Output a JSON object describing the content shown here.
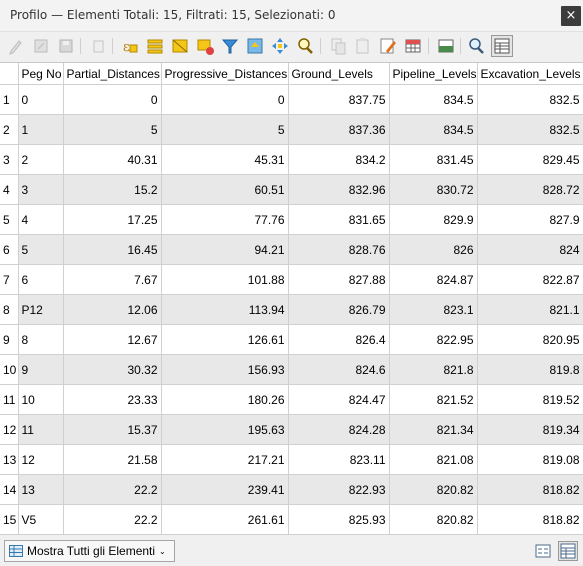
{
  "window": {
    "title": "Profilo — Elementi Totali: 15,  Filtrati: 15, Selezionati: 0",
    "close_glyph": "×"
  },
  "toolbar": {
    "icons": [
      "pencil-icon",
      "save-edits-icon",
      "save-icon",
      "delete-icon",
      "select-expression-icon",
      "select-all-icon",
      "invert-selection-icon",
      "deselect-icon",
      "filter-icon",
      "move-to-top-icon",
      "pan-to-icon",
      "zoom-to-icon",
      "copy-icon",
      "paste-icon",
      "field-calculator-icon",
      "conditional-format-icon",
      "dock-icon",
      "form-view-icon",
      "table-view-icon"
    ]
  },
  "table": {
    "columns": [
      "Peg No",
      "Partial_Distances",
      "Progressive_Distances",
      "Ground_Levels",
      "Pipeline_Levels",
      "Excavation_Levels"
    ],
    "rows": [
      {
        "n": "1",
        "peg": "0",
        "partial": "0",
        "progressive": "0",
        "ground": "837.75",
        "pipeline": "834.5",
        "excavation": "832.5"
      },
      {
        "n": "2",
        "peg": "1",
        "partial": "5",
        "progressive": "5",
        "ground": "837.36",
        "pipeline": "834.5",
        "excavation": "832.5"
      },
      {
        "n": "3",
        "peg": "2",
        "partial": "40.31",
        "progressive": "45.31",
        "ground": "834.2",
        "pipeline": "831.45",
        "excavation": "829.45"
      },
      {
        "n": "4",
        "peg": "3",
        "partial": "15.2",
        "progressive": "60.51",
        "ground": "832.96",
        "pipeline": "830.72",
        "excavation": "828.72"
      },
      {
        "n": "5",
        "peg": "4",
        "partial": "17.25",
        "progressive": "77.76",
        "ground": "831.65",
        "pipeline": "829.9",
        "excavation": "827.9"
      },
      {
        "n": "6",
        "peg": "5",
        "partial": "16.45",
        "progressive": "94.21",
        "ground": "828.76",
        "pipeline": "826",
        "excavation": "824"
      },
      {
        "n": "7",
        "peg": "6",
        "partial": "7.67",
        "progressive": "101.88",
        "ground": "827.88",
        "pipeline": "824.87",
        "excavation": "822.87"
      },
      {
        "n": "8",
        "peg": "P12",
        "partial": "12.06",
        "progressive": "113.94",
        "ground": "826.79",
        "pipeline": "823.1",
        "excavation": "821.1"
      },
      {
        "n": "9",
        "peg": "8",
        "partial": "12.67",
        "progressive": "126.61",
        "ground": "826.4",
        "pipeline": "822.95",
        "excavation": "820.95"
      },
      {
        "n": "10",
        "peg": "9",
        "partial": "30.32",
        "progressive": "156.93",
        "ground": "824.6",
        "pipeline": "821.8",
        "excavation": "819.8"
      },
      {
        "n": "11",
        "peg": "10",
        "partial": "23.33",
        "progressive": "180.26",
        "ground": "824.47",
        "pipeline": "821.52",
        "excavation": "819.52"
      },
      {
        "n": "12",
        "peg": "11",
        "partial": "15.37",
        "progressive": "195.63",
        "ground": "824.28",
        "pipeline": "821.34",
        "excavation": "819.34"
      },
      {
        "n": "13",
        "peg": "12",
        "partial": "21.58",
        "progressive": "217.21",
        "ground": "823.11",
        "pipeline": "821.08",
        "excavation": "819.08"
      },
      {
        "n": "14",
        "peg": "13",
        "partial": "22.2",
        "progressive": "239.41",
        "ground": "822.93",
        "pipeline": "820.82",
        "excavation": "818.82"
      },
      {
        "n": "15",
        "peg": "V5",
        "partial": "22.2",
        "progressive": "261.61",
        "ground": "825.93",
        "pipeline": "820.82",
        "excavation": "818.82"
      }
    ]
  },
  "status": {
    "show_all_label": "Mostra Tutti gli Elementi"
  }
}
